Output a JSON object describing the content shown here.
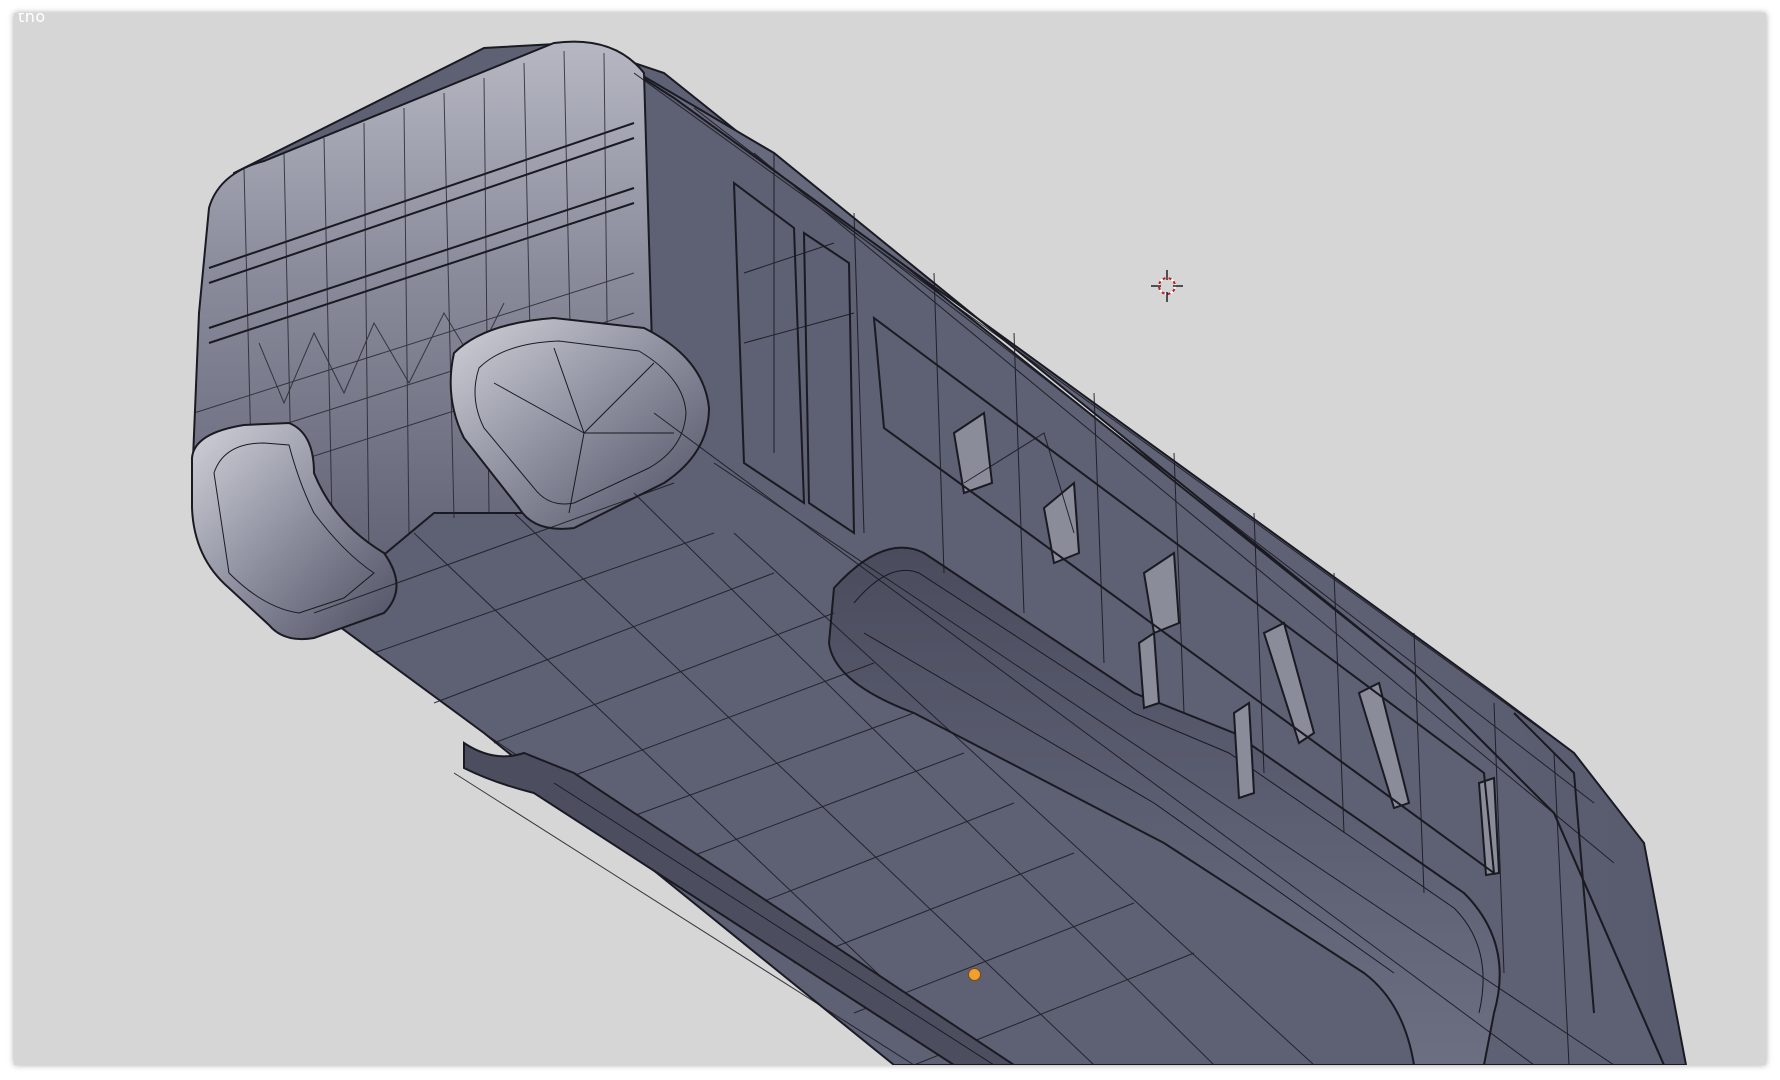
{
  "viewport": {
    "label": "tho",
    "background_color": "#d6d6d6",
    "mesh_color": "#626478",
    "wire_color": "#1a1a22",
    "origin_color": "#f0a030"
  },
  "icons": {
    "cursor": "3d-cursor-icon",
    "origin": "object-origin-icon"
  }
}
